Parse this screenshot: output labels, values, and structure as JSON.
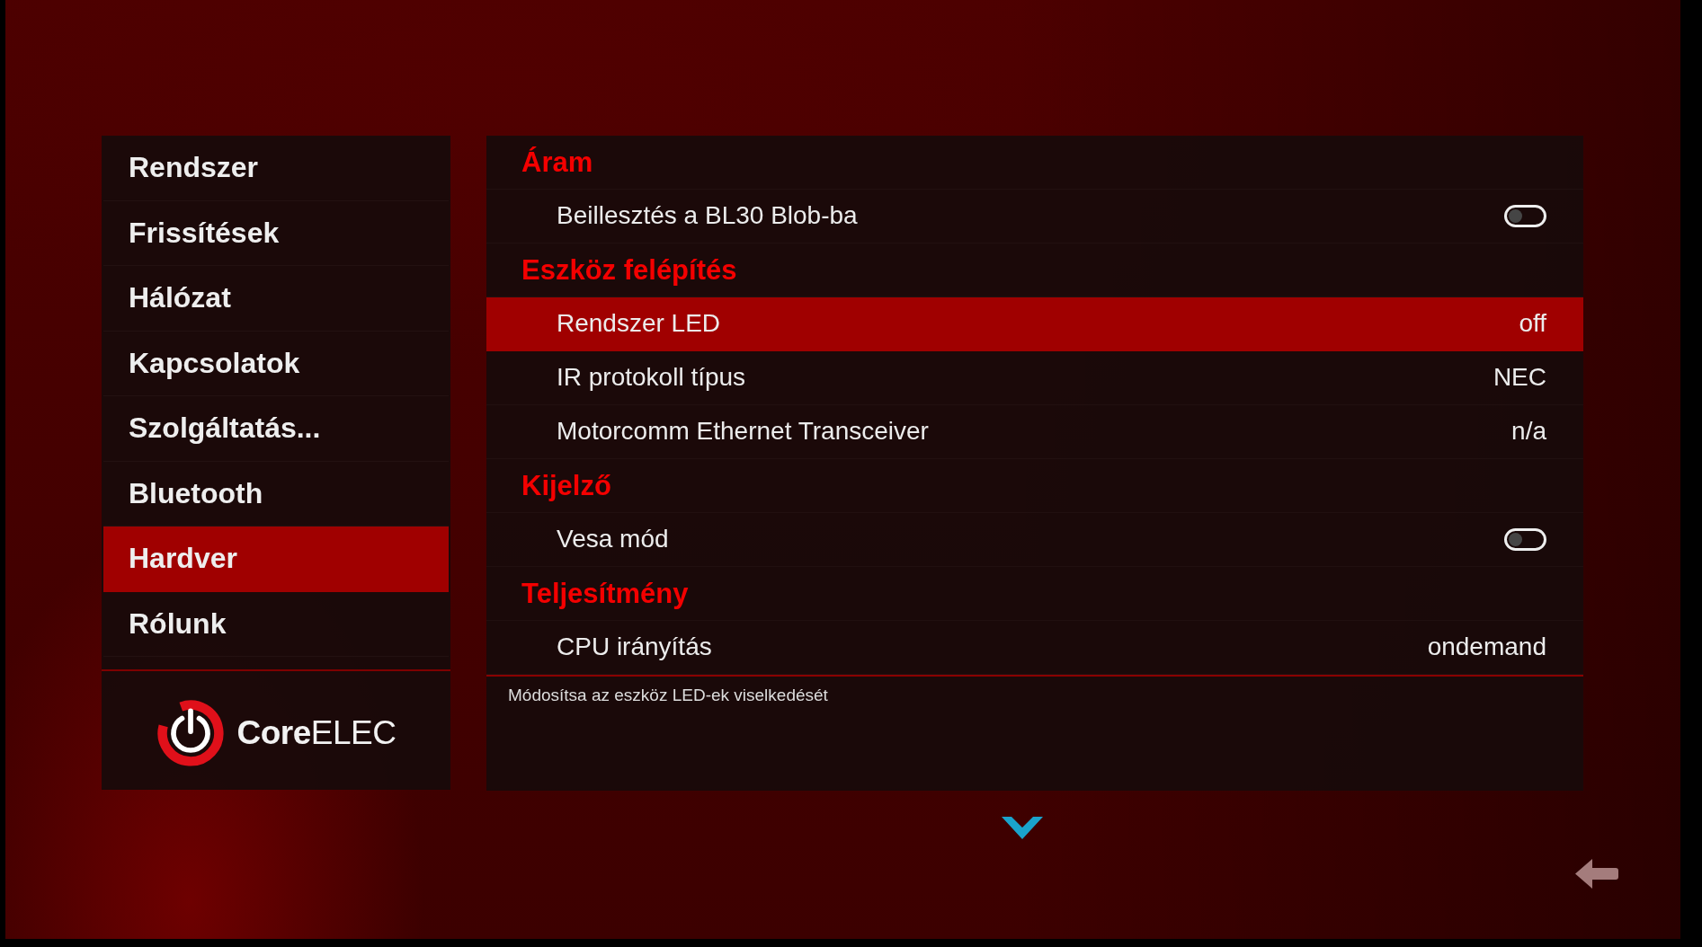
{
  "sidebar": {
    "items": [
      {
        "label": "Rendszer",
        "selected": false
      },
      {
        "label": "Frissítések",
        "selected": false
      },
      {
        "label": "Hálózat",
        "selected": false
      },
      {
        "label": "Kapcsolatok",
        "selected": false
      },
      {
        "label": "Szolgáltatás...",
        "selected": false
      },
      {
        "label": "Bluetooth",
        "selected": false
      },
      {
        "label": "Hardver",
        "selected": true
      },
      {
        "label": "Rólunk",
        "selected": false
      }
    ],
    "logo": {
      "text": "**Core**ELEC"
    }
  },
  "settings": {
    "groups": [
      {
        "title": "Áram",
        "items": [
          {
            "kind": "toggle",
            "label": "Beillesztés a BL30 Blob-ba",
            "on": false,
            "selected": false
          }
        ]
      },
      {
        "title": "Eszköz felépítés",
        "items": [
          {
            "kind": "value",
            "label": "Rendszer LED",
            "value": "off",
            "selected": true
          },
          {
            "kind": "value",
            "label": "IR protokoll típus",
            "value": "NEC",
            "selected": false
          },
          {
            "kind": "value",
            "label": "Motorcomm Ethernet Transceiver",
            "value": "n/a",
            "selected": false
          }
        ]
      },
      {
        "title": "Kijelző",
        "items": [
          {
            "kind": "toggle",
            "label": "Vesa mód",
            "on": false,
            "selected": false
          }
        ]
      },
      {
        "title": "Teljesítmény",
        "items": [
          {
            "kind": "value",
            "label": "CPU irányítás",
            "value": "ondemand",
            "selected": false
          }
        ]
      }
    ]
  },
  "description": "Módosítsa az eszköz LED-ek viselkedését"
}
